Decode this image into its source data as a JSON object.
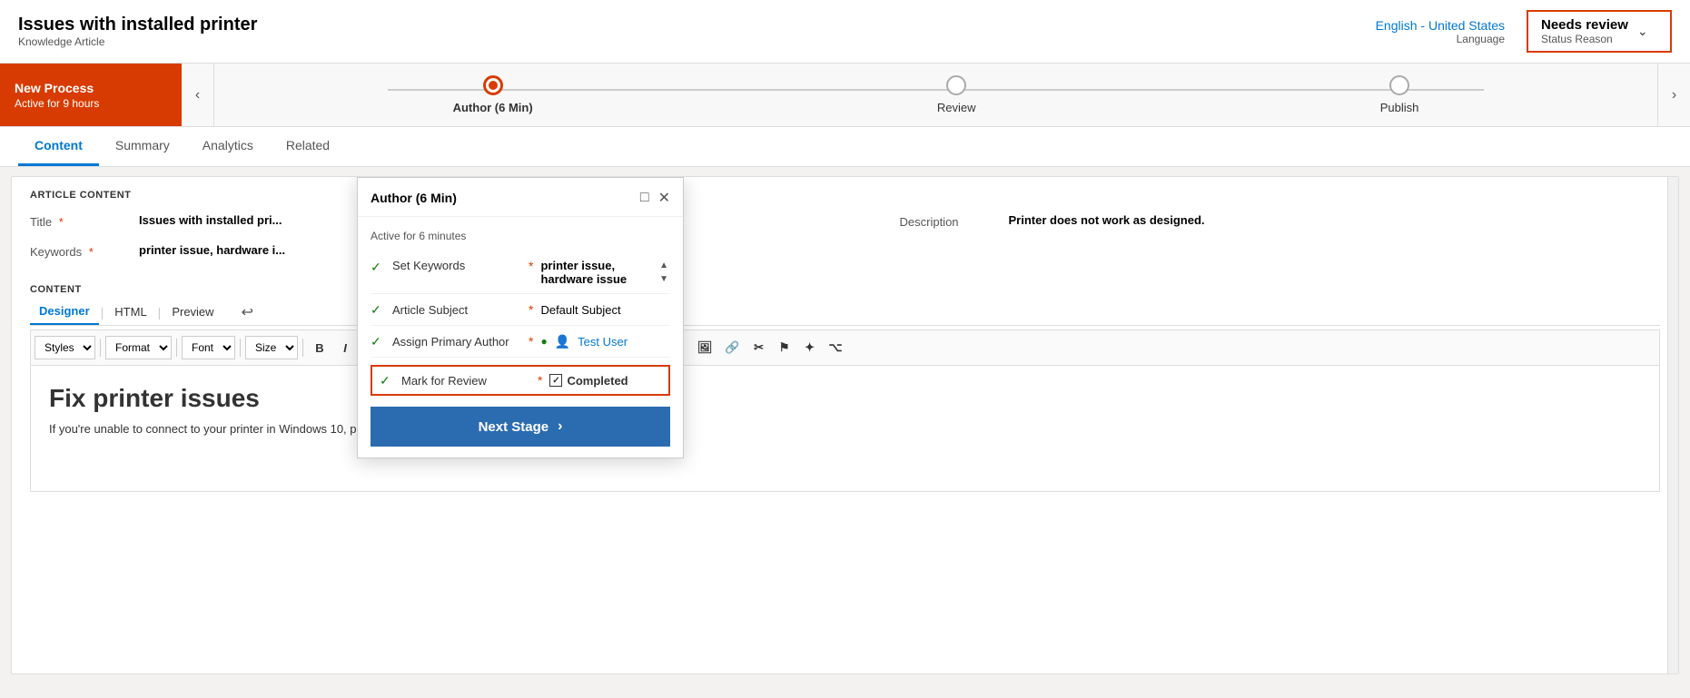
{
  "header": {
    "title": "Issues with installed printer",
    "subtitle": "Knowledge Article",
    "language": {
      "value": "English - United States",
      "label": "Language"
    },
    "status": {
      "value": "Needs review",
      "label": "Status Reason"
    }
  },
  "process_bar": {
    "badge_title": "New Process",
    "badge_subtitle": "Active for 9 hours",
    "stages": [
      {
        "label": "Author (6 Min)",
        "active": true
      },
      {
        "label": "Review",
        "active": false
      },
      {
        "label": "Publish",
        "active": false
      }
    ]
  },
  "tabs": [
    "Content",
    "Summary",
    "Analytics",
    "Related"
  ],
  "active_tab": "Content",
  "article_content": {
    "section_label": "ARTICLE CONTENT",
    "title_label": "Title",
    "title_value": "Issues with installed pri...",
    "keywords_label": "Keywords",
    "keywords_value": "printer issue, hardware i...",
    "description_label": "Description",
    "description_value": "Printer does not work as designed."
  },
  "content_section": {
    "section_label": "CONTENT",
    "editor_tabs": [
      "Designer",
      "HTML",
      "Preview"
    ],
    "active_editor_tab": "Designer",
    "toolbar": {
      "styles_label": "Styles",
      "format_label": "Format",
      "font_label": "Font",
      "size_label": "Size"
    },
    "editor_heading": "Fix printer issues",
    "editor_body": "If you're unable to connect to your printer in Windows 10, perform one of the following steps to address the issue:"
  },
  "popup": {
    "title": "Author (6 Min)",
    "active_label": "Active for 6 minutes",
    "rows": [
      {
        "id": "set-keywords",
        "checked": true,
        "label": "Set Keywords",
        "required": true,
        "value": "printer issue, hardware issue",
        "bold": false,
        "has_scroll": true
      },
      {
        "id": "article-subject",
        "checked": true,
        "label": "Article Subject",
        "required": true,
        "value": "Default Subject",
        "bold": false
      },
      {
        "id": "assign-author",
        "checked": true,
        "label": "Assign Primary Author",
        "required": true,
        "value": "Test User",
        "bold": false,
        "is_user": true
      },
      {
        "id": "mark-review",
        "checked": true,
        "label": "Mark for Review",
        "required": true,
        "value": "Completed",
        "bold": true,
        "highlighted": true
      }
    ],
    "next_stage_label": "Next Stage"
  }
}
